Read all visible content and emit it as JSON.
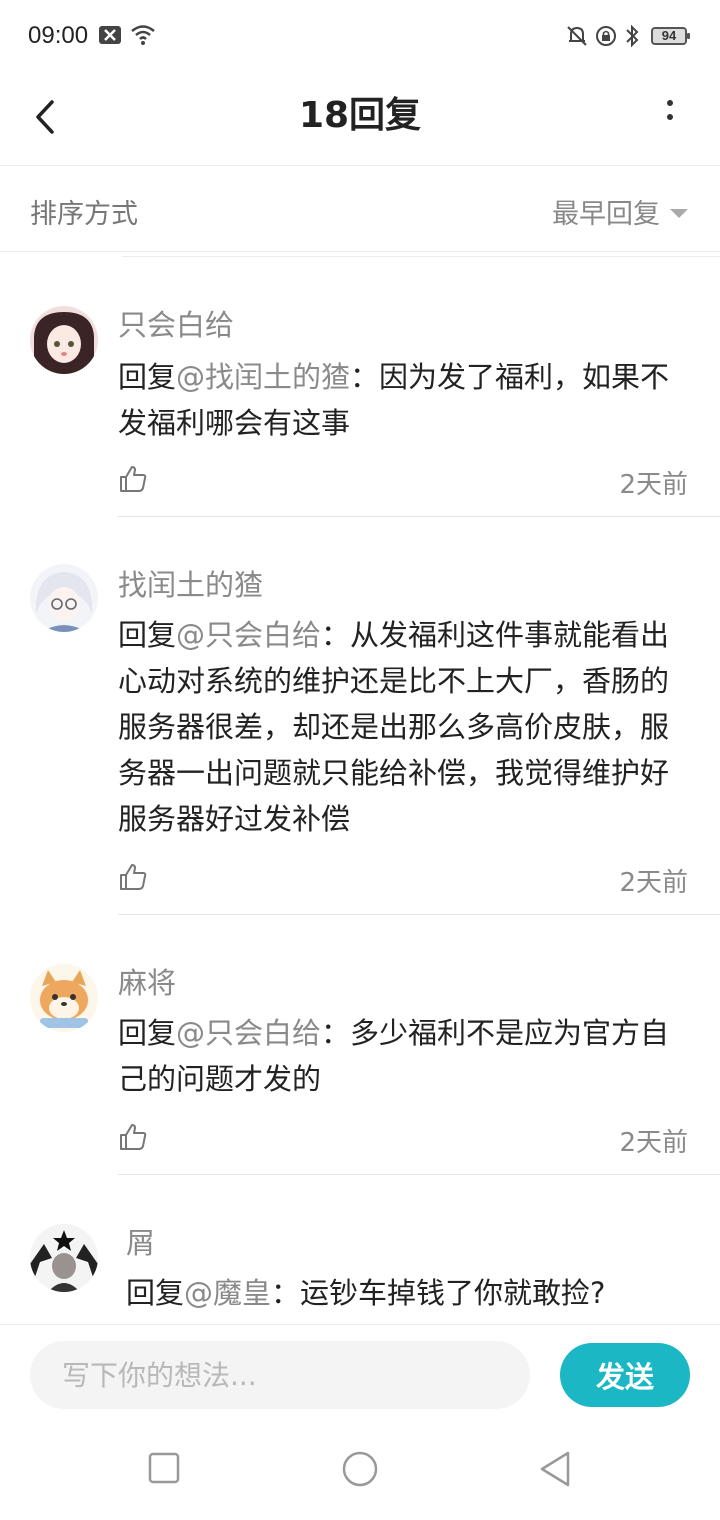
{
  "status_bar": {
    "time": "09:00",
    "battery": "94"
  },
  "header": {
    "title": "18回复"
  },
  "sort": {
    "label": "排序方式",
    "selected": "最早回复"
  },
  "comments": [
    {
      "user": "只会白给",
      "reply_prefix": "回复",
      "mention": "@找闰土的猹",
      "text": "：因为发了福利，如果不发福利哪会有这事",
      "time": "2天前"
    },
    {
      "user": "找闰土的猹",
      "reply_prefix": "回复",
      "mention": "@只会白给",
      "text": "：从发福利这件事就能看出心动对系统的维护还是比不上大厂，香肠的服务器很差，却还是出那么多高价皮肤，服务器一出问题就只能给补偿，我觉得维护好服务器好过发补偿",
      "time": "2天前"
    },
    {
      "user": "麻将",
      "reply_prefix": "回复",
      "mention": "@只会白给",
      "text": "：多少福利不是应为官方自己的问题才发的",
      "time": "2天前"
    },
    {
      "user": "屑",
      "reply_prefix": "回复",
      "mention": "@魔皇",
      "text": "：运钞车掉钱了你就敢捡?",
      "time": ""
    }
  ],
  "input_bar": {
    "placeholder": "写下你的想法...",
    "send_label": "发送"
  },
  "colors": {
    "accent": "#1bb7c5",
    "muted_text": "#8a8a8a"
  }
}
